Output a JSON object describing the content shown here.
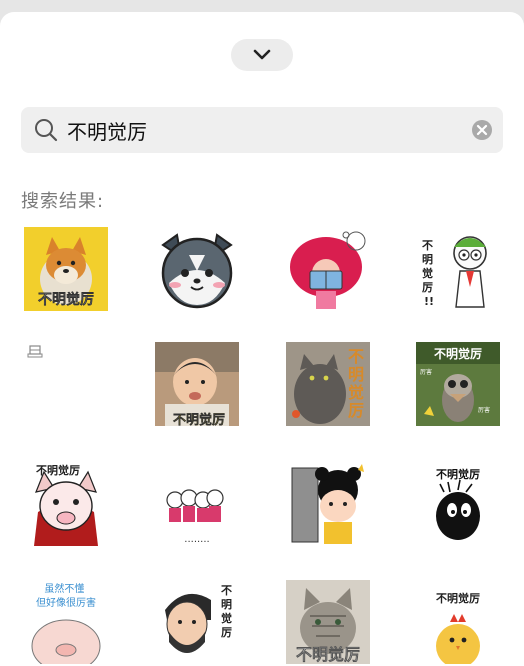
{
  "search": {
    "query": "不明觉厉"
  },
  "results": {
    "label": "搜索结果:",
    "stickers": [
      {
        "name": "shiba-dog-sticker",
        "caption": "不明觉厉"
      },
      {
        "name": "husky-face-sticker",
        "caption": ""
      },
      {
        "name": "afro-girl-reading-sticker",
        "caption": ""
      },
      {
        "name": "doodle-man-sticker",
        "caption": "不明觉厉!!"
      },
      {
        "name": "broken-image-sticker",
        "caption": ""
      },
      {
        "name": "child-photo-sticker",
        "caption": "不明觉厉"
      },
      {
        "name": "cat-photo-sticker",
        "caption": "不明觉厉"
      },
      {
        "name": "ostrich-photo-sticker",
        "caption": "不明觉厉",
        "tag_left": "厉害",
        "tag_right": "厉害"
      },
      {
        "name": "cartoon-dog-sticker",
        "caption": "不明觉厉"
      },
      {
        "name": "skeleton-group-sticker",
        "caption": "........"
      },
      {
        "name": "peeking-girl-sticker",
        "caption": ""
      },
      {
        "name": "black-ghost-sticker",
        "caption": "不明觉厉"
      },
      {
        "name": "pig-sticker",
        "caption": "虽然不懂 但好像很厉害"
      },
      {
        "name": "bearded-man-sticker",
        "caption": "不明觉厉"
      },
      {
        "name": "tabby-cat-sticker",
        "caption": "不明觉厉"
      },
      {
        "name": "chick-sticker",
        "caption": "不明觉厉"
      }
    ]
  }
}
